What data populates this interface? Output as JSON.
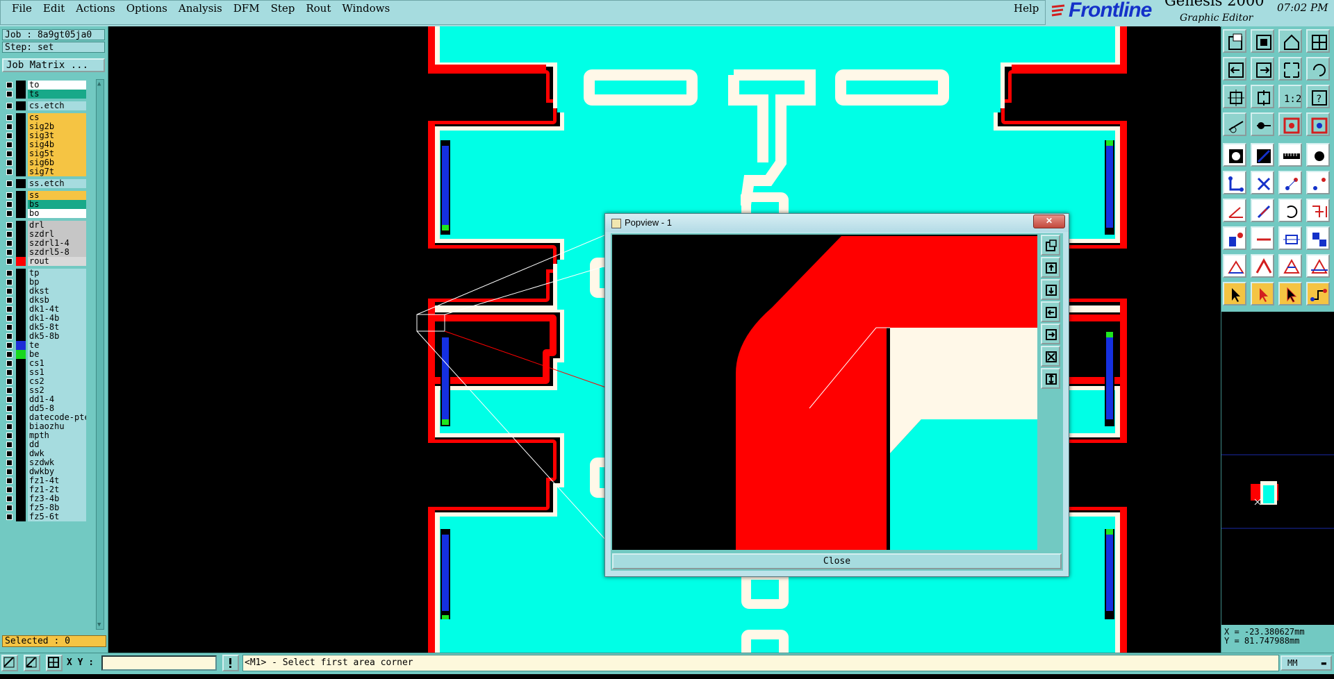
{
  "menu": {
    "items": [
      {
        "label": "File"
      },
      {
        "label": "Edit"
      },
      {
        "label": "Actions"
      },
      {
        "label": "Options"
      },
      {
        "label": "Analysis"
      },
      {
        "label": "DFM"
      },
      {
        "label": "Step"
      },
      {
        "label": "Rout"
      },
      {
        "label": "Windows"
      }
    ],
    "help": "Help"
  },
  "brand": {
    "logo": "Frontline",
    "product": "Genesis 2000",
    "subtitle": "Graphic Editor",
    "clock": "07:02 PM"
  },
  "job": {
    "job_text": "Job : 8a9gt05ja0",
    "step_text": "Step: set",
    "matrix_button": "Job Matrix ..."
  },
  "layers": [
    {
      "name": "to",
      "color": "#ffffff",
      "swatch": "#000000"
    },
    {
      "name": "ts",
      "color": "#18a989",
      "swatch": "#000000"
    },
    {
      "name": "cs.etch",
      "color": "#a6dcdf",
      "swatch": "#000000"
    },
    {
      "name": "cs",
      "color": "#f5c443",
      "swatch": "#000000"
    },
    {
      "name": "sig2b",
      "color": "#f5c443",
      "swatch": "#000000"
    },
    {
      "name": "sig3t",
      "color": "#f5c443",
      "swatch": "#000000"
    },
    {
      "name": "sig4b",
      "color": "#f5c443",
      "swatch": "#000000"
    },
    {
      "name": "sig5t",
      "color": "#f5c443",
      "swatch": "#000000"
    },
    {
      "name": "sig6b",
      "color": "#f5c443",
      "swatch": "#000000"
    },
    {
      "name": "sig7t",
      "color": "#f5c443",
      "swatch": "#000000"
    },
    {
      "name": "ss.etch",
      "color": "#a6dcdf",
      "swatch": "#000000"
    },
    {
      "name": "ss",
      "color": "#f5c443",
      "swatch": "#000000"
    },
    {
      "name": "bs",
      "color": "#18a989",
      "swatch": "#000000"
    },
    {
      "name": "bo",
      "color": "#ffffff",
      "swatch": "#000000"
    },
    {
      "name": "drl",
      "color": "#c6c6c6",
      "swatch": "#000000"
    },
    {
      "name": "szdrl",
      "color": "#c6c6c6",
      "swatch": "#000000"
    },
    {
      "name": "szdrl1-4",
      "color": "#c6c6c6",
      "swatch": "#000000"
    },
    {
      "name": "szdrl5-8",
      "color": "#c6c6c6",
      "swatch": "#000000"
    },
    {
      "name": "rout",
      "color": "#d9d9d9",
      "swatch": "#ff0000"
    },
    {
      "name": "tp",
      "color": "#a6dcdf",
      "swatch": "#000000"
    },
    {
      "name": "bp",
      "color": "#a6dcdf",
      "swatch": "#000000"
    },
    {
      "name": "dkst",
      "color": "#a6dcdf",
      "swatch": "#000000"
    },
    {
      "name": "dksb",
      "color": "#a6dcdf",
      "swatch": "#000000"
    },
    {
      "name": "dk1-4t",
      "color": "#a6dcdf",
      "swatch": "#000000"
    },
    {
      "name": "dk1-4b",
      "color": "#a6dcdf",
      "swatch": "#000000"
    },
    {
      "name": "dk5-8t",
      "color": "#a6dcdf",
      "swatch": "#000000"
    },
    {
      "name": "dk5-8b",
      "color": "#a6dcdf",
      "swatch": "#000000"
    },
    {
      "name": "te",
      "color": "#a6dcdf",
      "swatch": "#1d2dd8"
    },
    {
      "name": "be",
      "color": "#a6dcdf",
      "swatch": "#18d71e"
    },
    {
      "name": "cs1",
      "color": "#a6dcdf",
      "swatch": "#000000"
    },
    {
      "name": "ss1",
      "color": "#a6dcdf",
      "swatch": "#000000"
    },
    {
      "name": "cs2",
      "color": "#a6dcdf",
      "swatch": "#000000"
    },
    {
      "name": "ss2",
      "color": "#a6dcdf",
      "swatch": "#000000"
    },
    {
      "name": "dd1-4",
      "color": "#a6dcdf",
      "swatch": "#000000"
    },
    {
      "name": "dd5-8",
      "color": "#a6dcdf",
      "swatch": "#000000"
    },
    {
      "name": "datecode-pte",
      "color": "#a6dcdf",
      "swatch": "#000000"
    },
    {
      "name": "biaozhu",
      "color": "#a6dcdf",
      "swatch": "#000000"
    },
    {
      "name": "mpth",
      "color": "#a6dcdf",
      "swatch": "#000000"
    },
    {
      "name": "dd",
      "color": "#a6dcdf",
      "swatch": "#000000"
    },
    {
      "name": "dwk",
      "color": "#a6dcdf",
      "swatch": "#000000"
    },
    {
      "name": "szdwk",
      "color": "#a6dcdf",
      "swatch": "#000000"
    },
    {
      "name": "dwkby",
      "color": "#a6dcdf",
      "swatch": "#000000"
    },
    {
      "name": "fz1-4t",
      "color": "#a6dcdf",
      "swatch": "#000000"
    },
    {
      "name": "fz1-2t",
      "color": "#a6dcdf",
      "swatch": "#000000"
    },
    {
      "name": "fz3-4b",
      "color": "#a6dcdf",
      "swatch": "#000000"
    },
    {
      "name": "fz5-8b",
      "color": "#a6dcdf",
      "swatch": "#000000"
    },
    {
      "name": "fz5-6t",
      "color": "#a6dcdf",
      "swatch": "#000000"
    }
  ],
  "selected_text": "Selected : 0",
  "popview": {
    "title": "Popview - 1",
    "close_x": "✕",
    "close_button": "Close"
  },
  "coords": {
    "x_text": "X = -23.380627mm",
    "y_text": "Y = 81.747988mm"
  },
  "bottom": {
    "xy_label": "X Y :",
    "xy_value": "",
    "status": "<M1> - Select first area corner",
    "units": "MM"
  },
  "colors": {
    "board_fill": "#00ffe6",
    "rout_outline": "#ff0000",
    "silkscreen": "#fff8e8",
    "pad_blue": "#1530e0",
    "pad_green": "#1ee61e",
    "panel_bg": "#72c9c2"
  },
  "icons": {
    "tools": [
      "zoom-home-icon",
      "zoom-in-icon",
      "home-icon",
      "window-icon",
      "pan-left-icon",
      "pan-right-icon",
      "fit-icon",
      "redraw-icon",
      "zoom-area-icon",
      "zoom-extent-icon",
      "scale-1-2-icon",
      "help-icon",
      "measure-icon",
      "snap-icon",
      "layer-red-icon",
      "layer-blue-icon",
      "pad-icon",
      "line-icon",
      "ruler-icon",
      "circle-icon",
      "connect-icon",
      "cross-icon",
      "node-icon",
      "node-dot-icon",
      "angle-icon",
      "slash-icon",
      "rotate-icon",
      "align-icon",
      "copy-icon",
      "dash-icon",
      "move-icon",
      "array-icon",
      "triangle-icon",
      "triangle-pick-icon",
      "triangle-arrow-icon",
      "triangle-flat-icon",
      "select-arrow-icon",
      "select-arrow-red-icon",
      "select-arrow-orange-icon",
      "path-select-icon"
    ]
  }
}
